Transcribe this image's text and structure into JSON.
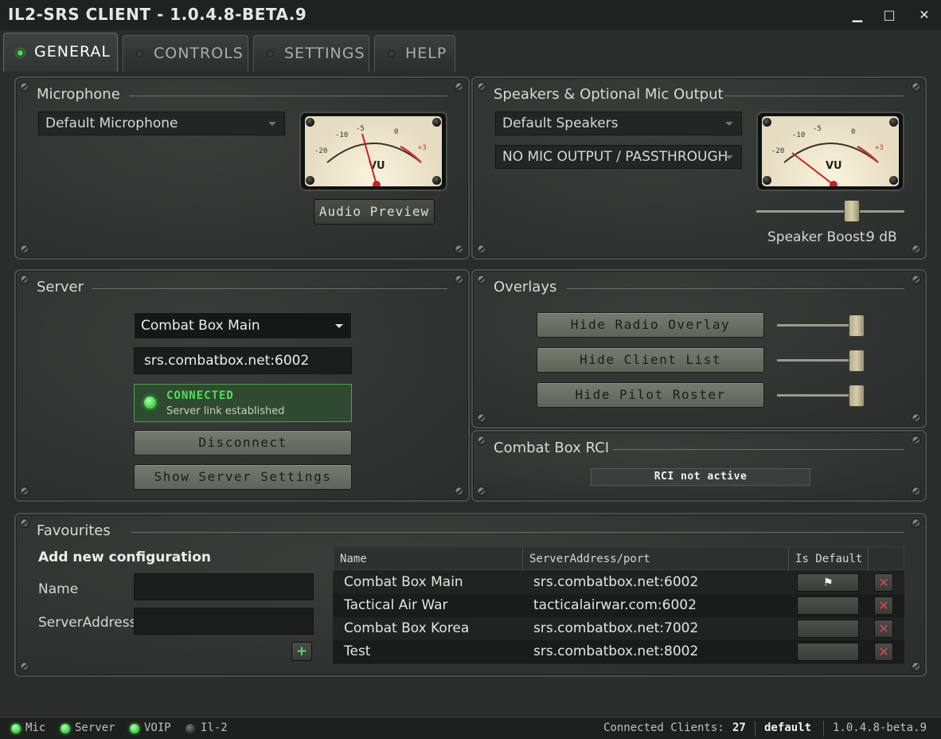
{
  "window": {
    "title": "IL2-SRS CLIENT - 1.0.4.8-BETA.9",
    "minimize": "▁",
    "maximize": "□",
    "close": "✕"
  },
  "tabs": [
    {
      "label": "GENERAL",
      "active": true
    },
    {
      "label": "CONTROLS",
      "active": false
    },
    {
      "label": "SETTINGS",
      "active": false
    },
    {
      "label": "HELP",
      "active": false
    }
  ],
  "microphone": {
    "title": "Microphone",
    "device": "Default Microphone",
    "preview_label": "Audio Preview",
    "vu": {
      "t20": "-20",
      "t10": "-10",
      "t5": "-5",
      "t0": "0",
      "t3": "+3",
      "vu": "VU"
    }
  },
  "speakers": {
    "title": "Speakers & Optional Mic Output",
    "device": "Default Speakers",
    "mic_output": "NO MIC OUTPUT / PASSTHROUGH",
    "boost_label": "Speaker Boost:",
    "boost_value": "9 dB",
    "boost_level": 0.66,
    "vu": {
      "t20": "-20",
      "t10": "-10",
      "t5": "-5",
      "t0": "0",
      "t3": "+3",
      "vu": "VU"
    }
  },
  "server": {
    "title": "Server",
    "selected": "Combat Box Main",
    "address": "srs.combatbox.net:6002",
    "status_title": "CONNECTED",
    "status_sub": "Server link established",
    "disconnect_label": "Disconnect",
    "settings_label": "Show Server Settings"
  },
  "overlays": {
    "title": "Overlays",
    "radio_label": "Hide Radio Overlay",
    "client_list_label": "Hide Client List",
    "pilot_roster_label": "Hide Pilot Roster"
  },
  "rci": {
    "title": "Combat Box RCI",
    "status": "RCI not active"
  },
  "favourites": {
    "title": "Favourites",
    "add_heading": "Add new configuration",
    "name_label": "Name",
    "address_label": "ServerAddress",
    "add_button": "+",
    "columns": [
      "Name",
      "ServerAddress/port",
      "Is Default"
    ],
    "rows": [
      {
        "name": "Combat Box Main",
        "address": "srs.combatbox.net:6002",
        "is_default": true
      },
      {
        "name": "Tactical Air War",
        "address": "tacticalairwar.com:6002",
        "is_default": false
      },
      {
        "name": "Combat Box Korea",
        "address": "srs.combatbox.net:7002",
        "is_default": false
      },
      {
        "name": "Test",
        "address": "srs.combatbox.net:8002",
        "is_default": false
      }
    ],
    "default_flag": "⚑",
    "delete_glyph": "✕"
  },
  "statusbar": {
    "mic": "Mic",
    "server": "Server",
    "voip": "VOIP",
    "il2": "Il-2",
    "clients_label": "Connected Clients:",
    "clients_count": "27",
    "profile": "default",
    "version": "1.0.4.8-beta.9"
  },
  "colors": {
    "led_on": "#43d34a",
    "delete_red": "#e0484a",
    "vu_needle": "#cc2222"
  }
}
